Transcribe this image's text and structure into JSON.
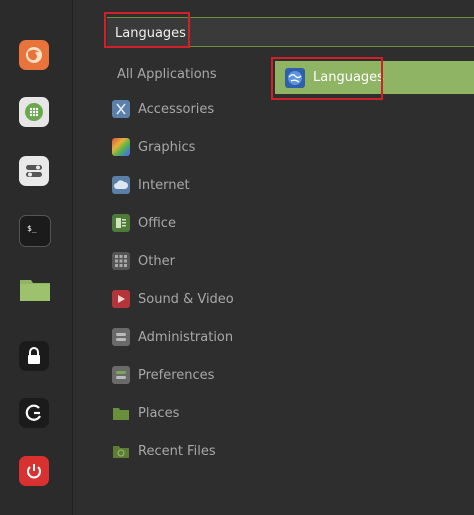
{
  "search": {
    "value": "Languages"
  },
  "categories": [
    {
      "label": "All Applications"
    },
    {
      "label": "Accessories"
    },
    {
      "label": "Graphics"
    },
    {
      "label": "Internet"
    },
    {
      "label": "Office"
    },
    {
      "label": "Other"
    },
    {
      "label": "Sound & Video"
    },
    {
      "label": "Administration"
    },
    {
      "label": "Preferences"
    },
    {
      "label": "Places"
    },
    {
      "label": "Recent Files"
    }
  ],
  "results": [
    {
      "label": "Languages",
      "icon": "languages-icon"
    }
  ],
  "dock": [
    {
      "name": "firefox-icon"
    },
    {
      "name": "software-manager-icon"
    },
    {
      "name": "system-settings-icon"
    },
    {
      "name": "terminal-icon"
    },
    {
      "name": "files-icon"
    },
    {
      "name": "lock-screen-icon"
    },
    {
      "name": "logout-icon"
    },
    {
      "name": "shutdown-icon"
    }
  ],
  "colors": {
    "accent": "#8eb464",
    "highlight": "#d0202a"
  }
}
